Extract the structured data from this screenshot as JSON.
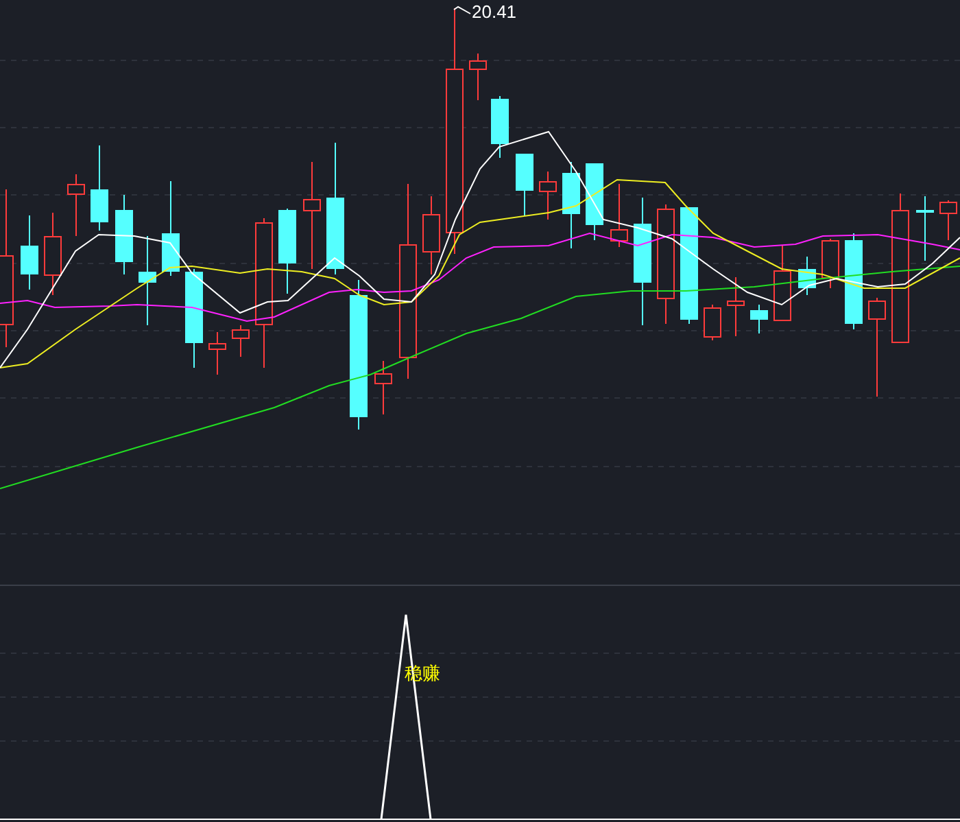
{
  "price_chart": {
    "high_label": "20.41"
  },
  "indicator_panel": {
    "signal_label": "稳赚"
  }
}
